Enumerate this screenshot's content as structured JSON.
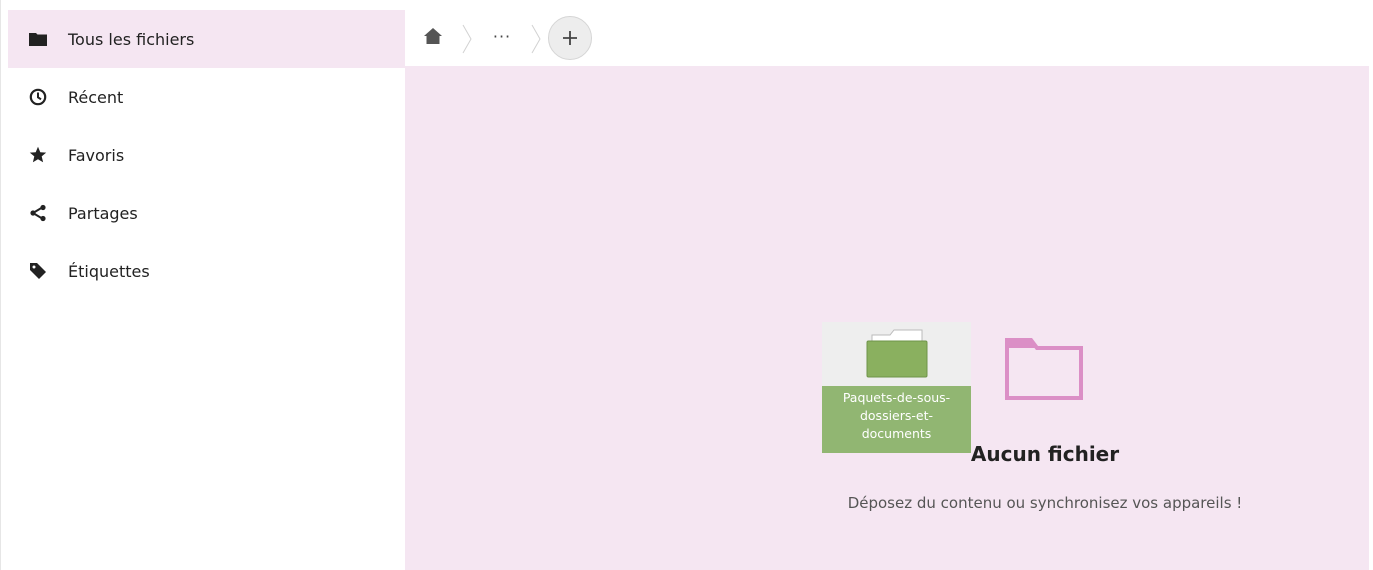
{
  "sidebar": {
    "items": [
      {
        "label": "Tous les fichiers",
        "icon": "folder-icon",
        "active": true
      },
      {
        "label": "Récent",
        "icon": "clock-icon",
        "active": false
      },
      {
        "label": "Favoris",
        "icon": "star-icon",
        "active": false
      },
      {
        "label": "Partages",
        "icon": "share-icon",
        "active": false
      },
      {
        "label": "Étiquettes",
        "icon": "tag-icon",
        "active": false
      }
    ]
  },
  "breadcrumb": {
    "home_icon": "home-icon",
    "more_label": "···",
    "add_icon": "plus-icon"
  },
  "empty_state": {
    "icon": "folder-outline-icon",
    "title": "Aucun fichier",
    "subtitle": "Déposez du contenu ou synchronisez vos appareils !"
  },
  "drag_preview": {
    "icon": "folder-icon",
    "name_lines": [
      "Paquets-de-sous-",
      "dossiers-et-",
      "documents"
    ]
  },
  "colors": {
    "accent_background": "#f5e6f2",
    "empty_folder_icon": "#db8fc6",
    "drag_folder": "#8ab05f",
    "drag_label_bg": "#91b672"
  }
}
